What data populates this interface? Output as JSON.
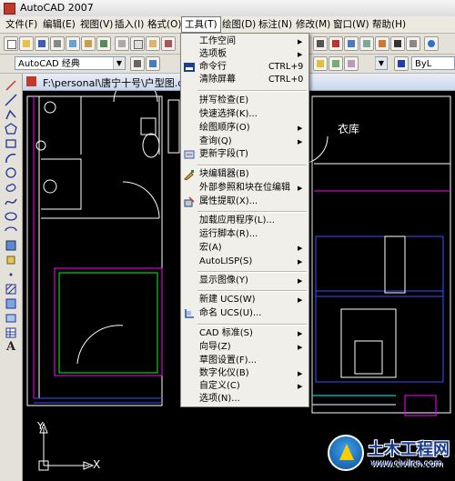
{
  "window": {
    "title": "AutoCAD 2007"
  },
  "menubar": [
    {
      "label": "文件(F)",
      "active": false
    },
    {
      "label": "编辑(E)",
      "active": false
    },
    {
      "label": "视图(V)",
      "active": false
    },
    {
      "label": "插入(I)",
      "active": false
    },
    {
      "label": "格式(O)",
      "active": false
    },
    {
      "label": "工具(T)",
      "active": true
    },
    {
      "label": "绘图(D)",
      "active": false
    },
    {
      "label": "标注(N)",
      "active": false
    },
    {
      "label": "修改(M)",
      "active": false
    },
    {
      "label": "窗口(W)",
      "active": false
    },
    {
      "label": "帮助(H)",
      "active": false
    }
  ],
  "toolbar": {
    "workspace_combo": "AutoCAD 经典",
    "layer_combo": "ByL"
  },
  "document": {
    "title": "F:\\personal\\唐宁十号\\户型图.dwg",
    "room_label": "衣库"
  },
  "ucs": {
    "x_label": "X",
    "y_label": "Y"
  },
  "tools_menu": {
    "items": [
      {
        "label": "工作空间",
        "submenu": true
      },
      {
        "label": "选项板",
        "submenu": true
      },
      {
        "label": "命令行",
        "shortcut": "CTRL+9",
        "icon": "command-line-icon"
      },
      {
        "label": "清除屏幕",
        "shortcut": "CTRL+0"
      },
      {
        "label": "拼写检查(E)"
      },
      {
        "label": "快速选择(K)..."
      },
      {
        "label": "绘图顺序(O)",
        "submenu": true
      },
      {
        "label": "查询(Q)",
        "submenu": true
      },
      {
        "label": "更新字段(T)",
        "icon": "update-fields-icon"
      },
      {
        "label": "块编辑器(B)",
        "icon": "block-editor-icon"
      },
      {
        "label": "外部参照和块在位编辑",
        "submenu": true
      },
      {
        "label": "属性提取(X)...",
        "icon": "attribute-extract-icon"
      },
      {
        "label": "加载应用程序(L)..."
      },
      {
        "label": "运行脚本(R)..."
      },
      {
        "label": "宏(A)",
        "submenu": true
      },
      {
        "label": "AutoLISP(S)",
        "submenu": true
      },
      {
        "label": "显示图像(Y)",
        "submenu": true
      },
      {
        "label": "新建 UCS(W)",
        "submenu": true
      },
      {
        "label": "命名 UCS(U)...",
        "icon": "named-ucs-icon"
      },
      {
        "label": "CAD 标准(S)",
        "submenu": true
      },
      {
        "label": "向导(Z)",
        "submenu": true
      },
      {
        "label": "草图设置(F)..."
      },
      {
        "label": "数字化仪(B)",
        "submenu": true
      },
      {
        "label": "自定义(C)",
        "submenu": true
      },
      {
        "label": "选项(N)..."
      }
    ]
  },
  "watermark": {
    "name": "土木工程网",
    "url": "www.civilcn.com"
  },
  "colors": {
    "canvas": "#000000",
    "wall_white": "#ffffff",
    "wall_magenta": "#ff00ff",
    "wall_blue": "#3355ff",
    "wall_green": "#00ff00",
    "wall_cyan": "#00ffff"
  }
}
